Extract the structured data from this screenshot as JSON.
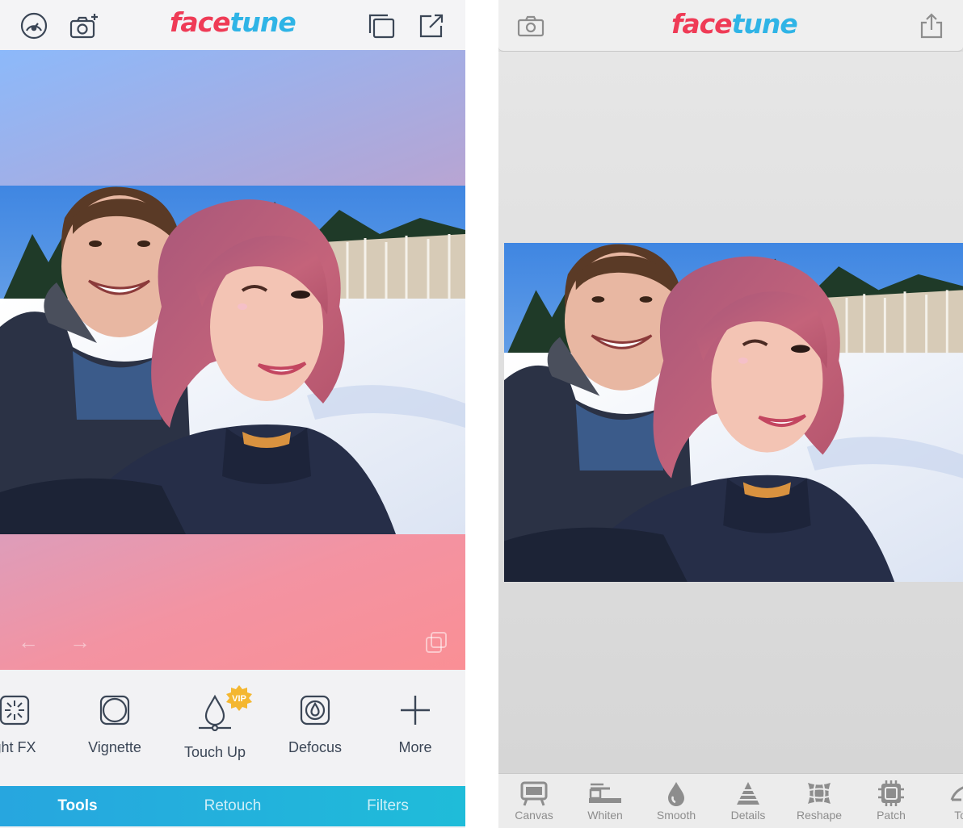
{
  "left_app": {
    "logo": {
      "part1": "face",
      "part2": "tune"
    },
    "header_icons": [
      "speed-dial-icon",
      "camera-plus-icon",
      "layers-icon",
      "share-icon"
    ],
    "tools": [
      {
        "label": "ght FX",
        "icon": "light-fx-icon"
      },
      {
        "label": "Vignette",
        "icon": "vignette-icon"
      },
      {
        "label": "Touch Up",
        "icon": "touch-up-icon",
        "badge": "VIP"
      },
      {
        "label": "Defocus",
        "icon": "defocus-icon"
      },
      {
        "label": "More",
        "icon": "plus-icon"
      }
    ],
    "tabs": [
      {
        "label": "Tools",
        "active": true
      },
      {
        "label": "Retouch",
        "active": false
      },
      {
        "label": "Filters",
        "active": false
      }
    ],
    "colors": {
      "logo_red": "#ef3b56",
      "logo_blue": "#2fb4e6",
      "tabbar": "#27a6df",
      "icon": "#3b4656"
    }
  },
  "right_app": {
    "logo": {
      "part1": "face",
      "part2": "tune"
    },
    "header_icons": [
      "camera-icon",
      "share-icon"
    ],
    "tools": [
      {
        "label": "Canvas",
        "icon": "canvas-icon"
      },
      {
        "label": "Whiten",
        "icon": "whiten-icon"
      },
      {
        "label": "Smooth",
        "icon": "smooth-icon"
      },
      {
        "label": "Details",
        "icon": "details-icon"
      },
      {
        "label": "Reshape",
        "icon": "reshape-icon"
      },
      {
        "label": "Patch",
        "icon": "patch-icon"
      },
      {
        "label": "Tor",
        "icon": "tone-icon"
      }
    ],
    "colors": {
      "icon": "#8d8d8d"
    }
  }
}
